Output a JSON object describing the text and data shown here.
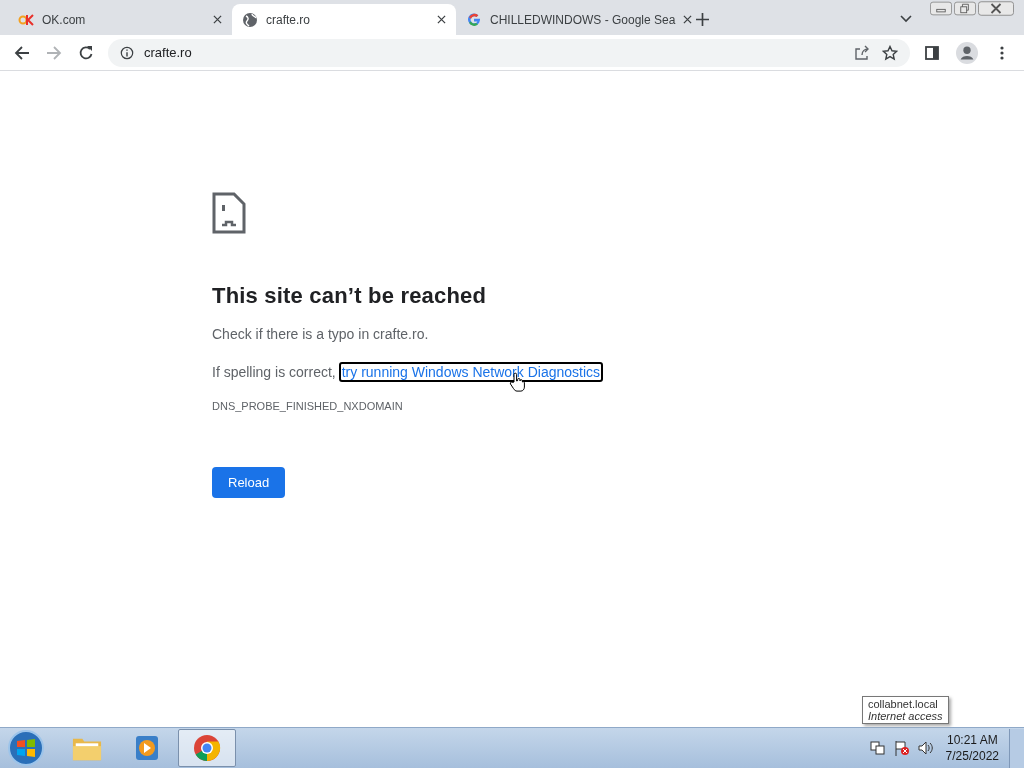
{
  "tabs": [
    {
      "title": "OK.com",
      "kind": "ok",
      "selected": false
    },
    {
      "title": "crafte.ro",
      "kind": "globe",
      "selected": true
    },
    {
      "title": "CHILLEDWINDOWS - Google Sea",
      "kind": "google",
      "selected": false
    }
  ],
  "address": {
    "url": "crafte.ro"
  },
  "error": {
    "heading": "This site can’t be reached",
    "hint": "Check if there is a typo in crafte.ro.",
    "prefix": "If spelling is correct,",
    "link": "try running Windows Network Diagnostics",
    "code": "DNS_PROBE_FINISHED_NXDOMAIN",
    "button": "Reload"
  },
  "tooltip": {
    "title": "collabnet.local",
    "subtitle": "Internet access"
  },
  "taskbar": {
    "apps": [
      {
        "kind": "explorer",
        "selected": false
      },
      {
        "kind": "media",
        "selected": false
      },
      {
        "kind": "chrome",
        "selected": true
      }
    ],
    "time": "10:21 AM",
    "date": "7/25/2022"
  }
}
